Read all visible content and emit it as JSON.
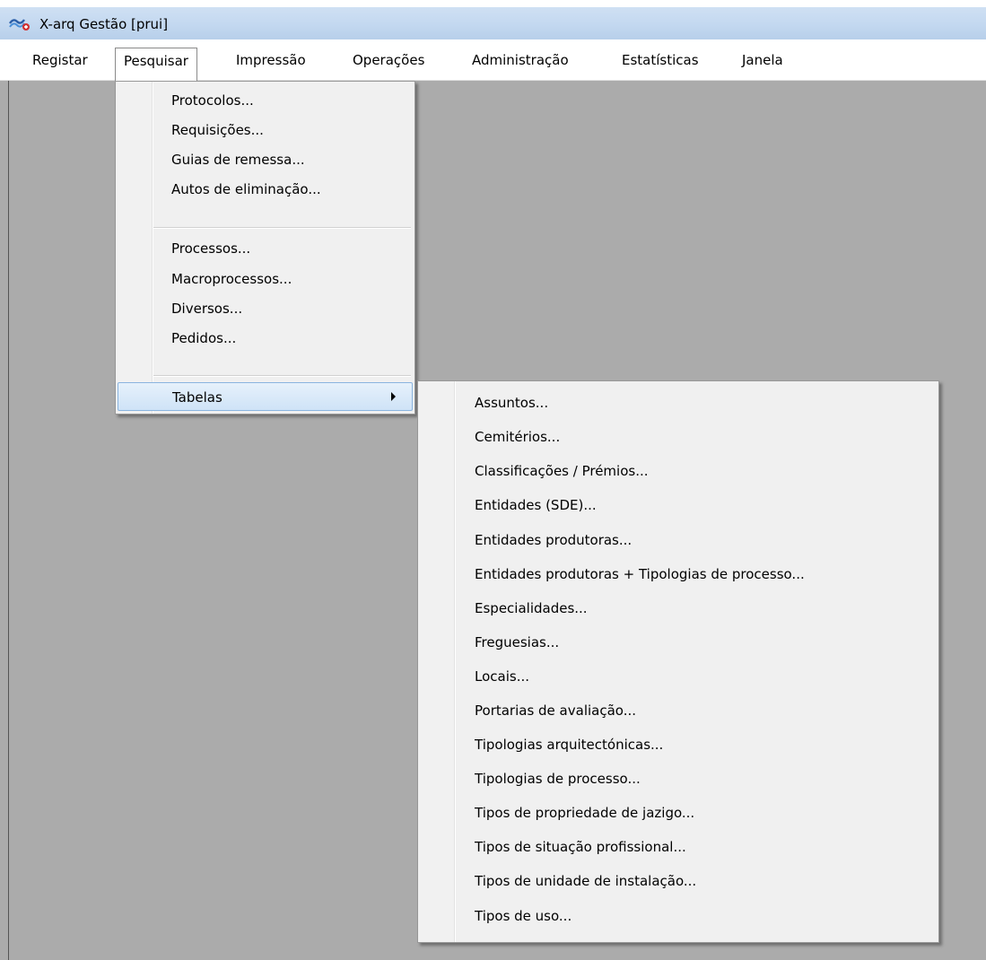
{
  "window": {
    "title": "X-arq Gestão [prui]",
    "icon": "app-logo-icon"
  },
  "menubar": {
    "items": [
      "Registar",
      "Pesquisar",
      "Impressão",
      "Operações",
      "Administração",
      "Estatísticas",
      "Janela"
    ],
    "active": "Pesquisar"
  },
  "pesquisar_menu": {
    "group1": [
      "Protocolos...",
      "Requisições...",
      "Guias de remessa...",
      "Autos de eliminação..."
    ],
    "group2": [
      "Processos...",
      "Macroprocessos...",
      "Diversos...",
      "Pedidos..."
    ],
    "tabelas": "Tabelas"
  },
  "tabelas_submenu": {
    "items": [
      "Assuntos...",
      "Cemitérios...",
      "Classificações / Prémios...",
      "Entidades (SDE)...",
      "Entidades produtoras...",
      "Entidades produtoras + Tipologias de processo...",
      "Especialidades...",
      "Freguesias...",
      "Locais...",
      "Portarias de avaliação...",
      "Tipologias arquitectónicas...",
      "Tipologias de processo...",
      "Tipos de propriedade de jazigo...",
      "Tipos de situação profissional...",
      "Tipos de unidade de instalação...",
      "Tipos de uso..."
    ]
  },
  "colors": {
    "workspace": "#ababab",
    "highlight": "#cfe3f7",
    "titlebar": "#c3d8f0"
  }
}
